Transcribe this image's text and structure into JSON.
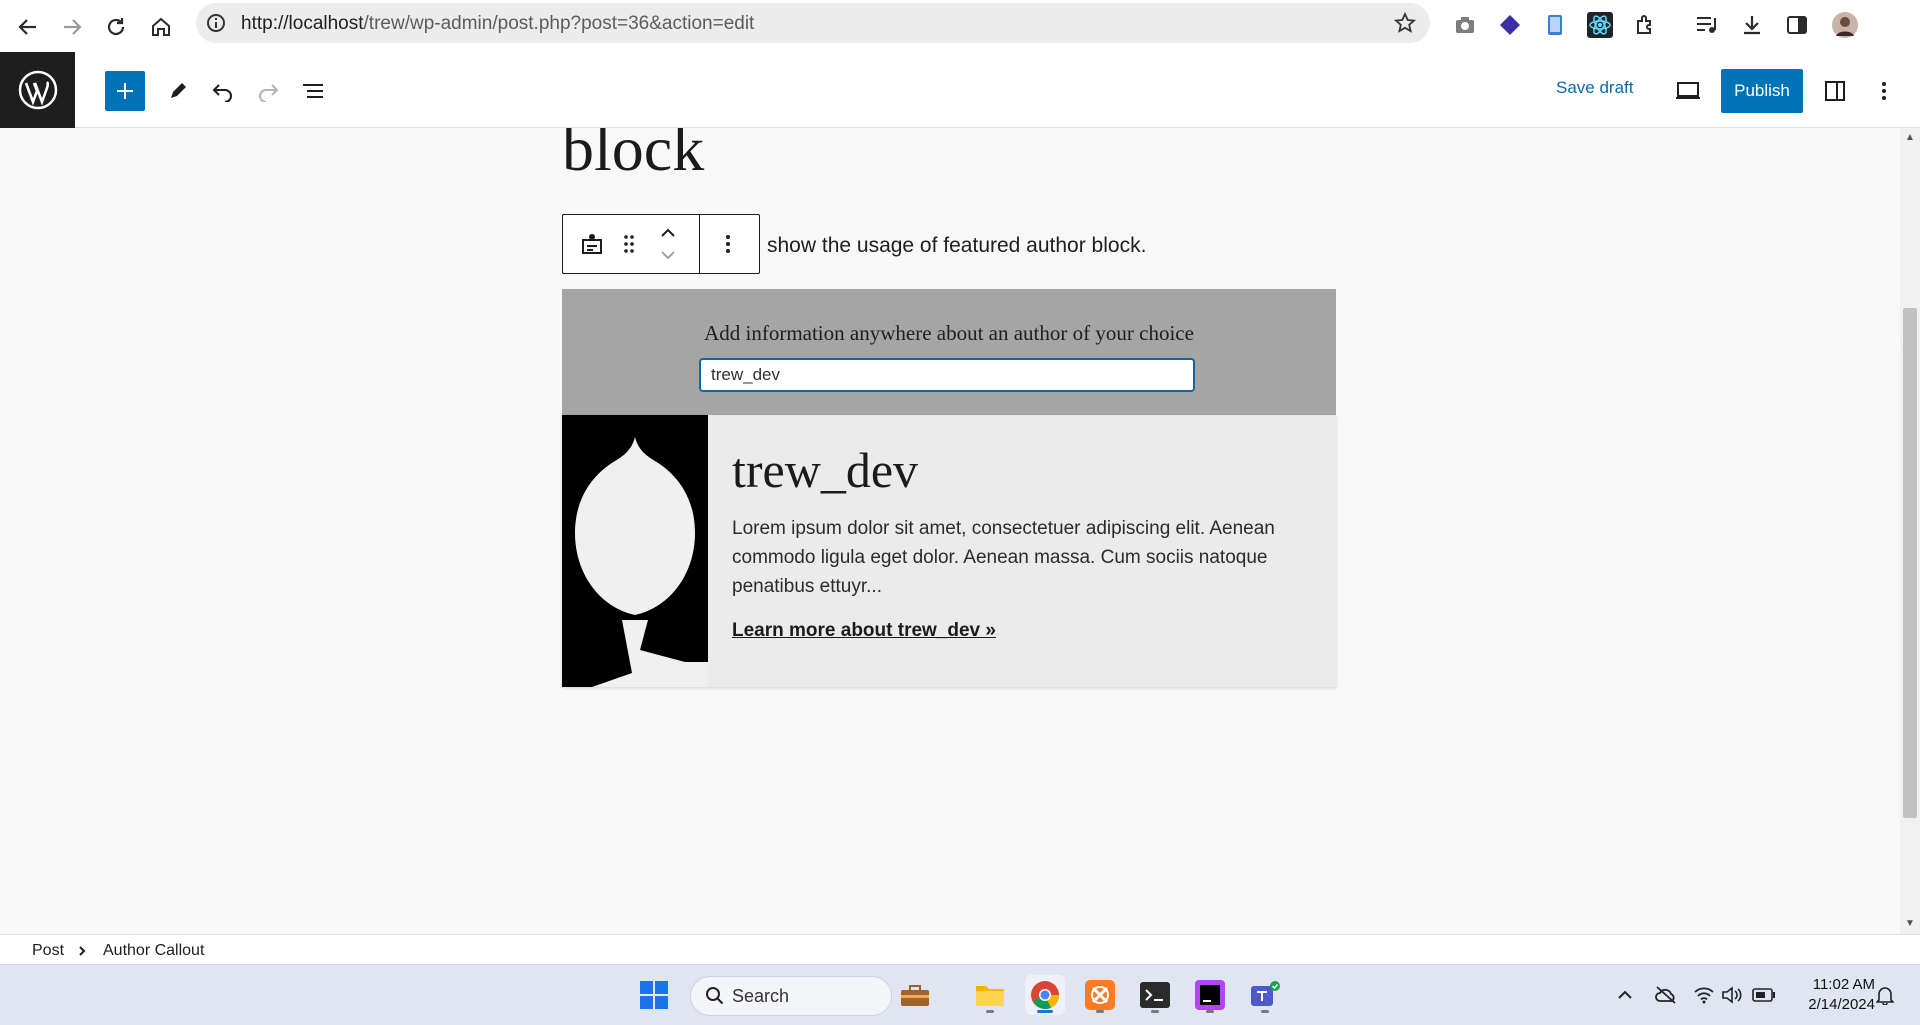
{
  "browser": {
    "url_host": "http://localhost",
    "url_path": "/trew/wp-admin/post.php?post=36&action=edit"
  },
  "editor": {
    "save_draft_label": "Save draft",
    "publish_label": "Publish"
  },
  "content": {
    "title_fragment": "block",
    "paragraph": "show the usage of featured author block.",
    "callout": {
      "prompt": "Add information anywhere about an author of your choice",
      "input_value": "trew_dev"
    },
    "author_card": {
      "name": "trew_dev",
      "bio": "Lorem ipsum dolor sit amet, consectetuer adipiscing elit. Aenean commodo ligula eget dolor. Aenean massa. Cum sociis natoque penatibus ettuyr...",
      "link": "Learn more about trew_dev »"
    }
  },
  "breadcrumb": [
    "Post",
    "Author Callout"
  ],
  "taskbar": {
    "search_label": "Search",
    "time": "11:02 AM",
    "date": "2/14/2024"
  },
  "colors": {
    "wp_blue": "#0073b8",
    "callout_bg": "#a5a5a5",
    "card_bg": "#ebebeb"
  }
}
